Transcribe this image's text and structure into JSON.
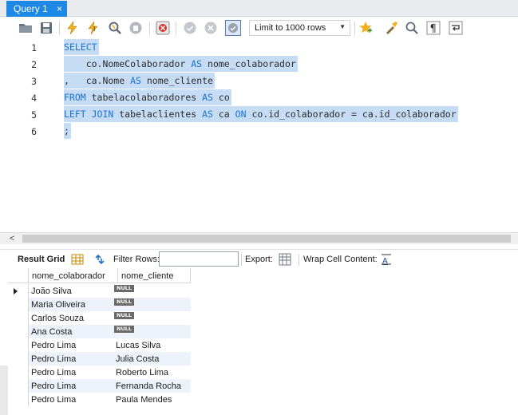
{
  "tab": {
    "title": "Query 1",
    "close_glyph": "×"
  },
  "toolbar": {
    "limit_label": "Limit to 1000 rows",
    "icons": [
      "open-folder-icon",
      "save-icon",
      "execute-icon",
      "execute-current-icon",
      "explain-icon",
      "stop-icon",
      "toggle-error-icon",
      "commit-icon",
      "rollback-icon",
      "autocommit-icon",
      "limit-dropdown",
      "bookmark-star-icon",
      "beautify-icon",
      "find-icon",
      "invisible-chars-icon",
      "wrap-icon"
    ]
  },
  "editor": {
    "line_numbers": [
      "1",
      "2",
      "3",
      "4",
      "5",
      "6"
    ],
    "lines": [
      [
        {
          "t": "SELECT",
          "k": "kw"
        }
      ],
      [
        {
          "t": "    co.NomeColaborador ",
          "k": "id"
        },
        {
          "t": "AS",
          "k": "kw"
        },
        {
          "t": " nome_colaborador",
          "k": "id"
        }
      ],
      [
        {
          "t": ",   ca.Nome ",
          "k": "id"
        },
        {
          "t": "AS",
          "k": "kw"
        },
        {
          "t": " nome_cliente",
          "k": "id"
        }
      ],
      [
        {
          "t": "FROM",
          "k": "kw"
        },
        {
          "t": " tabelacolaboradores ",
          "k": "id"
        },
        {
          "t": "AS",
          "k": "kw"
        },
        {
          "t": " co",
          "k": "id"
        }
      ],
      [
        {
          "t": "LEFT JOIN",
          "k": "kw"
        },
        {
          "t": " tabelaclientes ",
          "k": "id"
        },
        {
          "t": "AS",
          "k": "kw"
        },
        {
          "t": " ca ",
          "k": "id"
        },
        {
          "t": "ON",
          "k": "kw"
        },
        {
          "t": " co.id_colaborador = ca.id_colaborador",
          "k": "id"
        }
      ],
      [
        {
          "t": ";",
          "k": "id"
        }
      ]
    ]
  },
  "results_toolbar": {
    "result_grid_label": "Result Grid",
    "filter_label": "Filter Rows:",
    "filter_value": "",
    "export_label": "Export:",
    "wrap_label": "Wrap Cell Content:"
  },
  "grid": {
    "columns": [
      "nome_colaborador",
      "nome_cliente"
    ],
    "null_label": "NULL",
    "rows": [
      [
        "João Silva",
        null
      ],
      [
        "Maria Oliveira",
        null
      ],
      [
        "Carlos Souza",
        null
      ],
      [
        "Ana Costa",
        null
      ],
      [
        "Pedro Lima",
        "Lucas Silva"
      ],
      [
        "Pedro Lima",
        "Julia Costa"
      ],
      [
        "Pedro Lima",
        "Roberto Lima"
      ],
      [
        "Pedro Lima",
        "Fernanda Rocha"
      ],
      [
        "Pedro Lima",
        "Paula Mendes"
      ]
    ]
  },
  "colors": {
    "accent": "#1e88e5",
    "keyword": "#1973d1",
    "selection": "#c5dcf4",
    "alt_row": "#eef3fb"
  }
}
